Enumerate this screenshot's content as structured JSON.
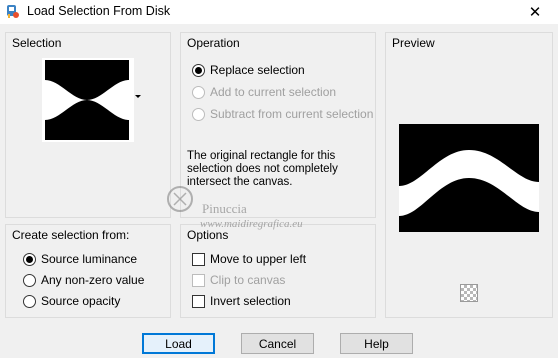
{
  "window": {
    "title": "Load Selection From Disk",
    "close_glyph": "✕"
  },
  "selection": {
    "title": "Selection"
  },
  "operation": {
    "title": "Operation",
    "options": [
      {
        "label": "Replace selection",
        "checked": true,
        "enabled": true
      },
      {
        "label": "Add to current selection",
        "checked": false,
        "enabled": false
      },
      {
        "label": "Subtract from current selection",
        "checked": false,
        "enabled": false
      }
    ],
    "message": "The original rectangle for this selection does not completely intersect the canvas."
  },
  "preview": {
    "title": "Preview"
  },
  "create_from": {
    "title": "Create selection from:",
    "options": [
      {
        "label": "Source luminance",
        "checked": true
      },
      {
        "label": "Any non-zero value",
        "checked": false
      },
      {
        "label": "Source opacity",
        "checked": false
      }
    ]
  },
  "options": {
    "title": "Options",
    "items": [
      {
        "label": "Move to upper left",
        "checked": false,
        "enabled": true
      },
      {
        "label": "Clip to canvas",
        "checked": false,
        "enabled": false
      },
      {
        "label": "Invert selection",
        "checked": false,
        "enabled": true
      }
    ]
  },
  "buttons": {
    "load": "Load",
    "cancel": "Cancel",
    "help": "Help"
  },
  "watermark": {
    "line1": "Pinuccia",
    "line2": "www.maidiregrafica.eu"
  },
  "colors": {
    "accent": "#0078d7",
    "dialog_bg": "#f0f0f0",
    "mask_black": "#000000",
    "mask_white": "#ffffff"
  }
}
